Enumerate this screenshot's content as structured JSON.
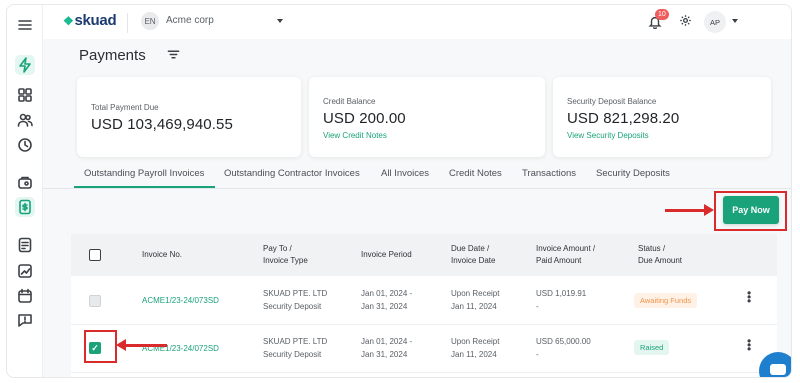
{
  "header": {
    "logo": "skuad",
    "org_initials": "EN",
    "org_name": "Acme corp",
    "notification_count": "10",
    "user_initials": "AP"
  },
  "page": {
    "title": "Payments"
  },
  "cards": [
    {
      "label": "Total Payment Due",
      "amount": "USD 103,469,940.55",
      "link": ""
    },
    {
      "label": "Credit Balance",
      "amount": "USD 200.00",
      "link": "View Credit Notes"
    },
    {
      "label": "Security Deposit Balance",
      "amount": "USD 821,298.20",
      "link": "View Security Deposits"
    }
  ],
  "tabs": [
    {
      "label": "Outstanding Payroll Invoices",
      "active": true
    },
    {
      "label": "Outstanding Contractor Invoices",
      "active": false
    },
    {
      "label": "All Invoices",
      "active": false
    },
    {
      "label": "Credit Notes",
      "active": false
    },
    {
      "label": "Transactions",
      "active": false
    },
    {
      "label": "Security Deposits",
      "active": false
    }
  ],
  "actions": {
    "pay_now": "Pay Now"
  },
  "table": {
    "headers": {
      "invoice_no": "Invoice No.",
      "pay_to_1": "Pay To /",
      "pay_to_2": "Invoice Type",
      "period": "Invoice Period",
      "due_1": "Due Date /",
      "due_2": "Invoice Date",
      "amount_1": "Invoice Amount /",
      "amount_2": "Paid Amount",
      "status_1": "Status /",
      "status_2": "Due Amount"
    },
    "rows": [
      {
        "checked": false,
        "disabled": true,
        "invoice_no": "ACME1/23-24/073SD",
        "pay_to": "SKUAD PTE. LTD",
        "invoice_type": "Security Deposit",
        "period_start": "Jan 01, 2024 -",
        "period_end": "Jan 31, 2024",
        "due_date": "Upon Receipt",
        "invoice_date": "Jan 11, 2024",
        "invoice_amount": "USD 1,019.91",
        "paid_amount": "-",
        "status": "Awaiting Funds"
      },
      {
        "checked": true,
        "disabled": false,
        "invoice_no": "ACME1/23-24/072SD",
        "pay_to": "SKUAD PTE. LTD",
        "invoice_type": "Security Deposit",
        "period_start": "Jan 01, 2024 -",
        "period_end": "Jan 31, 2024",
        "due_date": "Upon Receipt",
        "invoice_date": "Jan 11, 2024",
        "invoice_amount": "USD 65,000.00",
        "paid_amount": "-",
        "status": "Raised"
      }
    ]
  },
  "colors": {
    "accent": "#1aa27a",
    "highlight": "#d92b2b",
    "status_awaiting_bg": "#fff1e6",
    "status_awaiting_fg": "#f0954a",
    "status_raised_bg": "#e3f6ef",
    "status_raised_fg": "#1aa27a"
  }
}
